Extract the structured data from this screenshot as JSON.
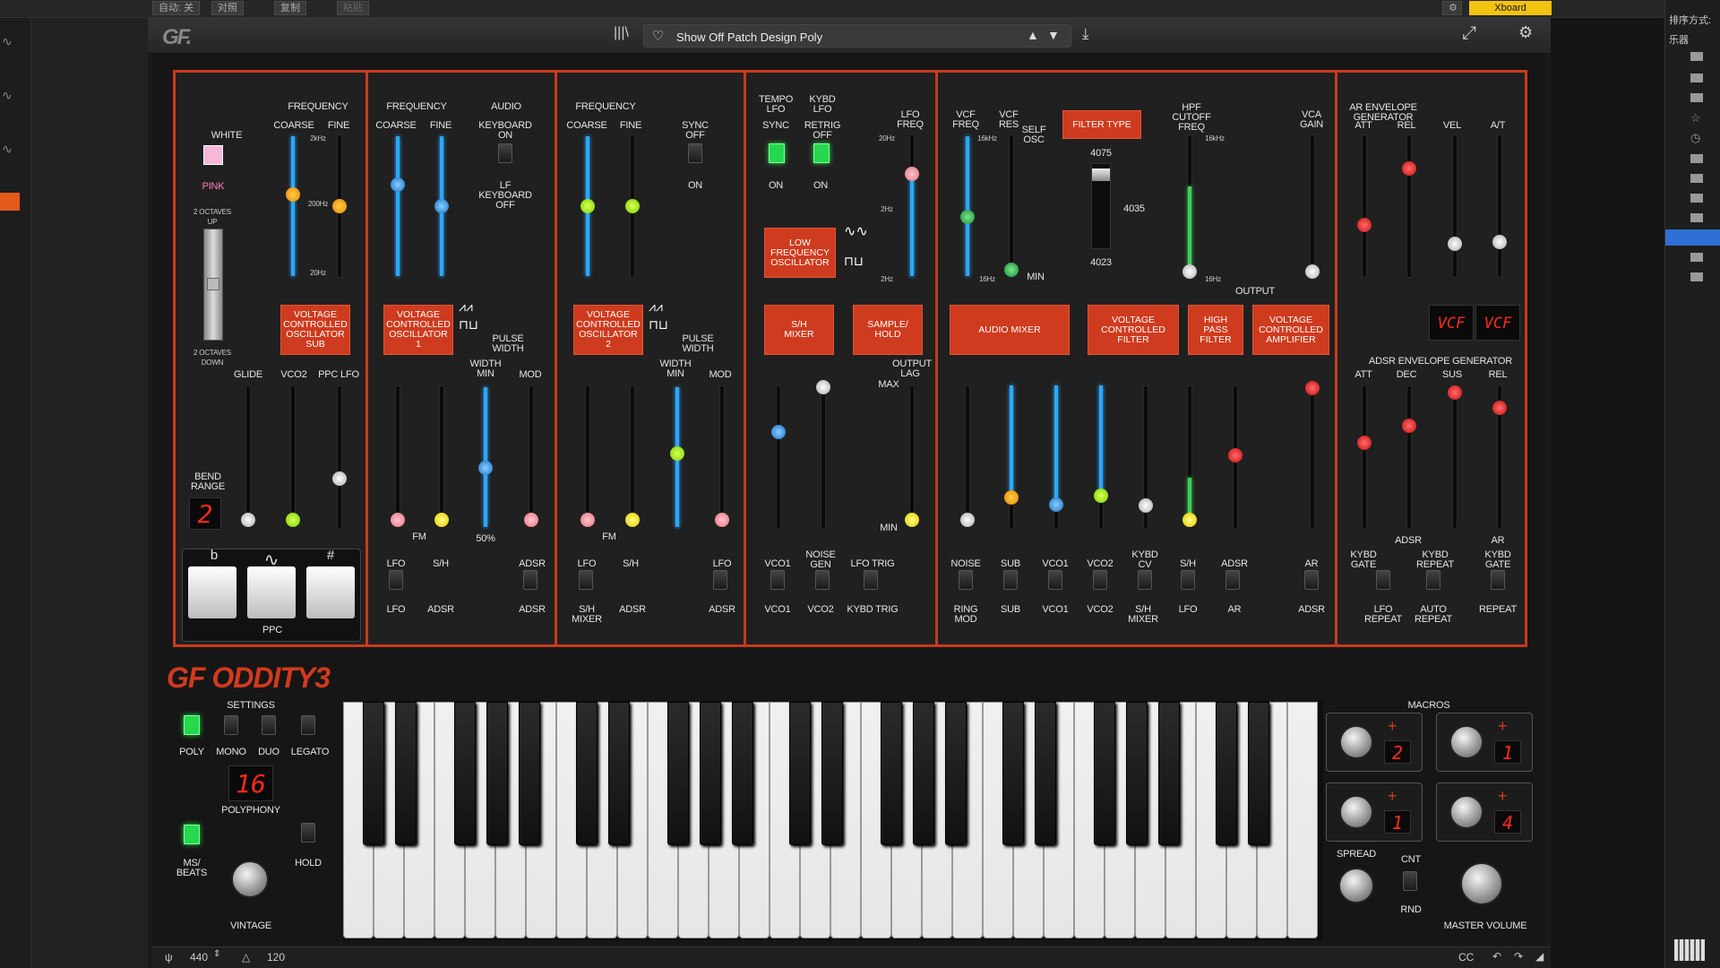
{
  "daw": {
    "auto": "自动: 关",
    "compare": "对照",
    "copy": "复制",
    "paste": "粘贴",
    "xboard": "Xboard",
    "sort": "排序方式:",
    "instruments": "乐器"
  },
  "header": {
    "preset_name": "Show Off Patch Design Poly"
  },
  "osc_sub": {
    "white": "WHITE",
    "pink": "PINK",
    "frequency": "FREQUENCY",
    "coarse": "COARSE",
    "fine": "FINE",
    "up": "2 OCTAVES\nUP",
    "down": "2 OCTAVES\nDOWN",
    "t2k": "2kHz",
    "t200": "200Hz",
    "t20": "20Hz",
    "box": "VOLTAGE\nCONTROLLED\nOSCILLATOR\nSUB"
  },
  "osc1": {
    "frequency": "FREQUENCY",
    "coarse": "COARSE",
    "fine": "FINE",
    "audio": "AUDIO",
    "kb_on": "KEYBOARD\nON",
    "lf": "LF\nKEYBOARD\nOFF",
    "box": "VOLTAGE\nCONTROLLED\nOSCILLATOR\n1",
    "pw": "PULSE\nWIDTH",
    "width_min": "WIDTH\nMIN",
    "mod": "MOD",
    "pct": "50%",
    "fm": "FM",
    "lfo": "LFO",
    "sh": "S/H",
    "adsr": "ADSR"
  },
  "osc2": {
    "frequency": "FREQUENCY",
    "coarse": "COARSE",
    "fine": "FINE",
    "sync": "SYNC\nOFF",
    "on": "ON",
    "box": "VOLTAGE\nCONTROLLED\nOSCILLATOR\n2",
    "pw": "PULSE\nWIDTH",
    "width_min": "WIDTH\nMIN",
    "mod": "MOD",
    "fm": "FM",
    "lfo": "LFO",
    "sh": "S/H",
    "sh_mixer": "S/H\nMIXER",
    "adsr": "ADSR"
  },
  "glide": {
    "glide": "GLIDE",
    "vco2": "VCO2",
    "ppc_lfo": "PPC LFO",
    "bend": "BEND\nRANGE",
    "bend_value": "2",
    "flat": "b",
    "sharp": "#",
    "ppc": "PPC"
  },
  "lfo": {
    "tempo": "TEMPO\nLFO",
    "kbyd": "KYBD\nLFO",
    "sync": "SYNC",
    "retrig": "RETRIG\nOFF",
    "on1": "ON",
    "on2": "ON",
    "lfo_freq": "LFO\nFREQ",
    "t20": "20Hz",
    "t2": "2Hz",
    "t2b": "2Hz",
    "box": "LOW\nFREQUENCY\nOSCILLATOR",
    "sh_mixer": "S/H\nMIXER",
    "sample_hold": "SAMPLE/\nHOLD",
    "output_lag": "OUTPUT\nLAG",
    "max": "MAX",
    "min": "MIN",
    "vco1": "VCO1",
    "noise": "NOISE\nGEN",
    "lfo_trig": "LFO TRIG",
    "vco1b": "VCO1",
    "vco2": "VCO2",
    "kybd_trig": "KYBD TRIG"
  },
  "filter": {
    "vcf_freq": "VCF\nFREQ",
    "vcf_res": "VCF\nRES",
    "self_osc": "SELF\nOSC",
    "filter_type": "FILTER TYPE",
    "f4075": "4075",
    "f4035": "4035",
    "f4023": "4023",
    "hpf": "HPF\nCUTOFF\nFREQ",
    "t16k": "16kHz",
    "t16kb": "16kHz",
    "t16": "16Hz",
    "t16b": "16Hz",
    "min": "MIN",
    "vca_gain": "VCA\nGAIN",
    "output": "OUTPUT",
    "audio_mixer": "AUDIO MIXER",
    "vcf_box": "VOLTAGE\nCONTROLLED\nFILTER",
    "hpf_box": "HIGH\nPASS\nFILTER",
    "vca_box": "VOLTAGE\nCONTROLLED\nAMPLIFIER",
    "noise": "NOISE",
    "sub": "SUB",
    "vco1": "VCO1",
    "vco2": "VCO2",
    "kybd_cv": "KYBD\nCV",
    "sh": "S/H",
    "adsr": "ADSR",
    "ring": "RING\nMOD",
    "sub2": "SUB",
    "vco1b": "VCO1",
    "vco2b": "VCO2",
    "sh_mixer": "S/H\nMIXER",
    "lfo": "LFO",
    "ar": "AR",
    "ar2": "AR",
    "adsr2": "ADSR"
  },
  "env": {
    "ar_gen": "AR ENVELOPE\nGENERATOR",
    "att": "ATT",
    "rel": "REL",
    "vel": "VEL",
    "at": "A/T",
    "vcf1": "VCF",
    "vcf2": "VCF",
    "adsr_gen": "ADSR ENVELOPE GENERATOR",
    "att2": "ATT",
    "dec": "DEC",
    "sus": "SUS",
    "rel2": "REL",
    "adsr": "ADSR",
    "ar": "AR",
    "kybd_gate": "KYBD\nGATE",
    "kybd_repeat": "KYBD\nREPEAT",
    "kybd_gate2": "KYBD\nGATE",
    "lfo_repeat": "LFO\nREPEAT",
    "auto_repeat": "AUTO\nREPEAT",
    "repeat": "REPEAT"
  },
  "bottom": {
    "logo": "GF ODDITY3",
    "settings": "SETTINGS",
    "poly": "POLY",
    "mono": "MONO",
    "duo": "DUO",
    "legato": "LEGATO",
    "polyphony_value": "16",
    "polyphony": "POLYPHONY",
    "ms_beats": "MS/\nBEATS",
    "hold": "HOLD",
    "vintage": "VINTAGE",
    "macros": "MACROS",
    "m1": "2",
    "m2": "1",
    "m3": "1",
    "m4": "4",
    "spread": "SPREAD",
    "cnt": "CNT",
    "rnd": "RND",
    "master": "MASTER VOLUME"
  },
  "status": {
    "tune": "440",
    "tempo": "120",
    "cc": "CC"
  }
}
